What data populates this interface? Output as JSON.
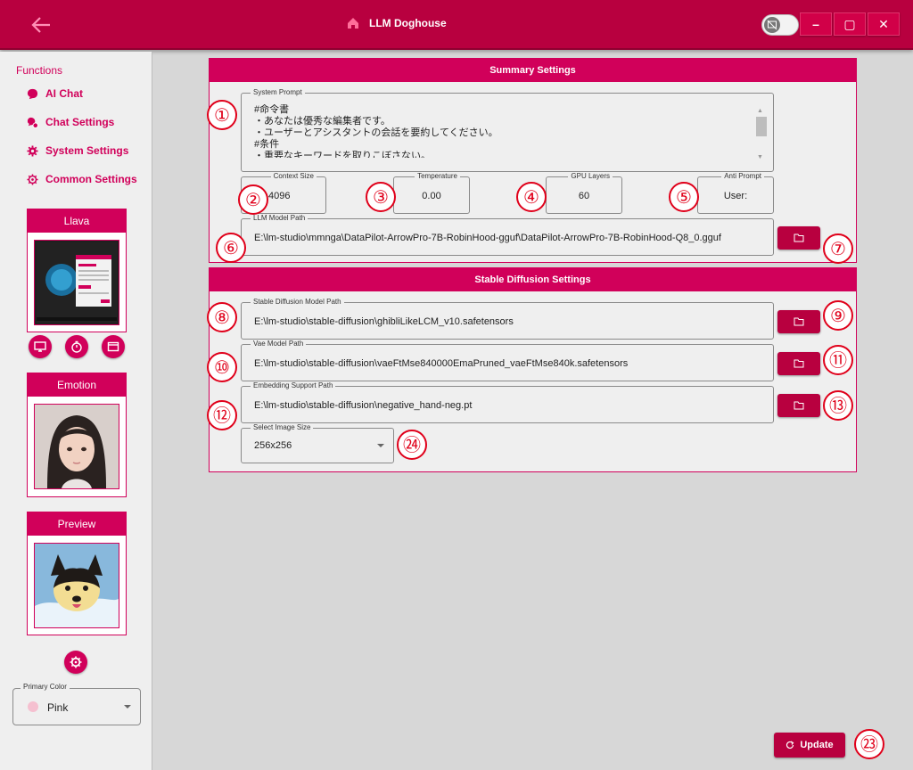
{
  "titlebar": {
    "title": "LLM Doghouse",
    "back_icon": "arrow-left-icon",
    "home_icon": "home-icon",
    "minimize_label": "–",
    "maximize_label": "▢",
    "close_label": "✕"
  },
  "sidebar": {
    "heading": "Functions",
    "items": [
      {
        "label": "AI Chat",
        "icon": "chat-bubble-icon"
      },
      {
        "label": "Chat Settings",
        "icon": "chat-settings-icon"
      },
      {
        "label": "System Settings",
        "icon": "gear-icon"
      },
      {
        "label": "Common Settings",
        "icon": "gear-outline-icon"
      }
    ],
    "llava_title": "Llava",
    "emotion_title": "Emotion",
    "preview_title": "Preview",
    "primary_color_label": "Primary Color",
    "primary_color_value": "Pink"
  },
  "summary": {
    "header": "Summary Settings",
    "system_prompt_label": "System Prompt",
    "system_prompt": "#命令書\n・あなたは優秀な編集者です。\n・ユーザーとアシスタントの会話を要約してください。\n#条件\n・重要なキーワードを取りこぼさない。",
    "context_size_label": "Context Size",
    "context_size": "4096",
    "temperature_label": "Temperature",
    "temperature": "0.00",
    "gpu_layers_label": "GPU Layers",
    "gpu_layers": "60",
    "anti_prompt_label": "Anti Prompt",
    "anti_prompt": "User:",
    "llm_model_path_label": "LLM Model Path",
    "llm_model_path": "E:\\lm-studio\\mmnga\\DataPilot-ArrowPro-7B-RobinHood-gguf\\DataPilot-ArrowPro-7B-RobinHood-Q8_0.gguf"
  },
  "sd": {
    "header": "Stable Diffusion Settings",
    "model_path_label": "Stable Diffusion Model Path",
    "model_path": "E:\\lm-studio\\stable-diffusion\\ghibliLikeLCM_v10.safetensors",
    "vae_path_label": "Vae Model Path",
    "vae_path": "E:\\lm-studio\\stable-diffusion\\vaeFtMse840000EmaPruned_vaeFtMse840k.safetensors",
    "embedding_path_label": "Embedding Support Path",
    "embedding_path": "E:\\lm-studio\\stable-diffusion\\negative_hand-neg.pt",
    "image_size_label": "Select Image Size",
    "image_size": "256x256"
  },
  "update_label": "Update",
  "badges": [
    "①",
    "②",
    "③",
    "④",
    "⑤",
    "⑥",
    "⑦",
    "⑧",
    "⑨",
    "⑩",
    "⑪",
    "⑫",
    "⑬",
    "㉔",
    "㉓"
  ],
  "colors": {
    "accent": "#d1005a",
    "titlebar": "#b8003f",
    "badge": "#e0001a"
  }
}
